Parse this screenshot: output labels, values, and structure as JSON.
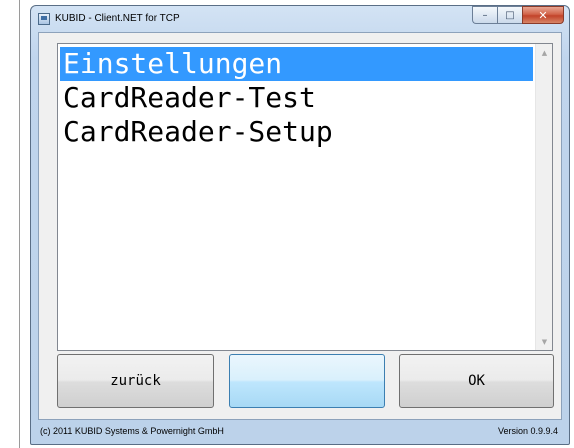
{
  "window": {
    "title": "KUBID - Client.NET for TCP",
    "controls": {
      "minimize": "–",
      "maximize": "□",
      "close": "✕"
    }
  },
  "list": {
    "items": [
      {
        "label": "Einstellungen",
        "selected": true
      },
      {
        "label": "CardReader-Test",
        "selected": false
      },
      {
        "label": "CardReader-Setup",
        "selected": false
      }
    ],
    "scroll_up": "▲",
    "scroll_down": "▼"
  },
  "buttons": {
    "back_label": "zurück",
    "middle_label": "",
    "ok_label": "OK"
  },
  "status": {
    "copyright": "(c) 2011 KUBID Systems & Powernight GmbH",
    "version": "Version 0.9.9.4"
  },
  "colors": {
    "selection": "#3399ff",
    "title_gradient": "#c0d5ed",
    "close_button": "#c2432a"
  }
}
